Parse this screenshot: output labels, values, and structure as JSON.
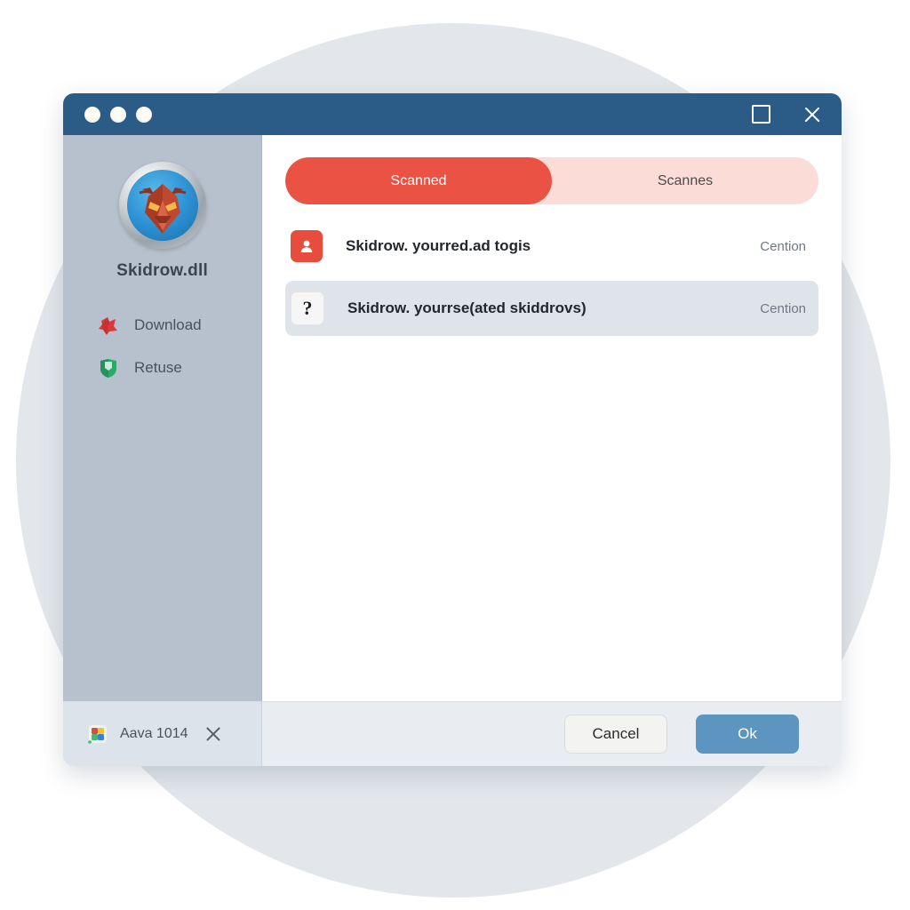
{
  "background": {
    "page_color": "#ffffff",
    "circle_color": "#e3e7eb"
  },
  "window": {
    "titlebar": {
      "color": "#2b5c87",
      "traffic_lights": [
        "dot-1",
        "dot-2",
        "dot-3"
      ],
      "maximize_icon": "maximize-icon",
      "close_icon": "close-icon"
    },
    "accent_red": "#ea5243",
    "accent_blue": "#5d95c1"
  },
  "sidebar": {
    "background_color": "#b6c1cd",
    "logo_icon": "demon-shield-logo",
    "app_name": "Skidrow.dll",
    "items": [
      {
        "label": "Download",
        "icon": "download-burst-icon",
        "color": "#d83b3b"
      },
      {
        "label": "Retuse",
        "icon": "green-shield-icon",
        "color": "#2ba96a"
      }
    ]
  },
  "main": {
    "tabs": [
      {
        "label": "Scanned",
        "active": true
      },
      {
        "label": "Scannes",
        "active": false
      }
    ],
    "rows": [
      {
        "icon": "user-danger-icon",
        "icon_style": "danger",
        "title": "Skidrow. yourred.ad togis",
        "status": "Cention",
        "selected": false
      },
      {
        "icon": "question-mark-icon",
        "icon_style": "unknown",
        "glyph": "?",
        "title": "Skidrow. yourrse(ated skiddrovs)",
        "status": "Cention",
        "selected": true
      }
    ]
  },
  "footer": {
    "chip": {
      "icon": "multicolor-app-icon",
      "label": "Aava 1014",
      "close_icon": "chip-close-icon"
    },
    "cancel_label": "Cancel",
    "ok_label": "Ok"
  }
}
